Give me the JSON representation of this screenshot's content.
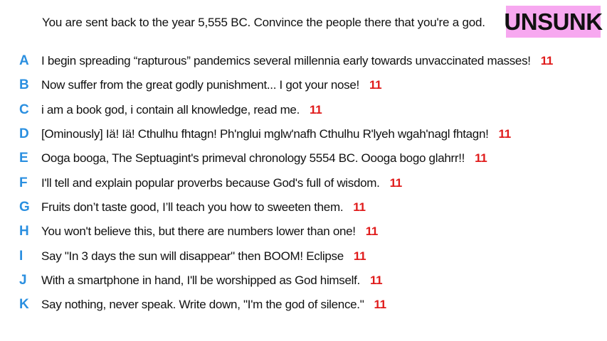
{
  "prompt": "You are sent back to the year 5,555 BC. Convince the people there that you're a god.",
  "logo": {
    "text": "UNSUNK",
    "bg": "#f7a8f0"
  },
  "colors": {
    "letter": "#2a8fe0",
    "score": "#e01b1b"
  },
  "answers": [
    {
      "letter": "A",
      "text": "I begin spreading “rapturous” pandemics several millennia early towards unvaccinated masses!",
      "score": "11"
    },
    {
      "letter": "B",
      "text": "Now suffer from the great godly punishment...  I got your nose!",
      "score": "11"
    },
    {
      "letter": "C",
      "text": "i am a book god, i contain all knowledge, read me.",
      "score": "11"
    },
    {
      "letter": "D",
      "text": "[Ominously] Iä! Iä! Cthulhu fhtagn! Ph'nglui mglw'nafh Cthulhu R'lyeh wgah'nagl fhtagn!",
      "score": "11"
    },
    {
      "letter": "E",
      "text": "Ooga booga, The Septuagint's primeval chronology 5554 BC. Oooga bogo glahrr!!",
      "score": "11"
    },
    {
      "letter": "F",
      "text": "I'll tell and explain popular proverbs because God's full of wisdom.",
      "score": "11"
    },
    {
      "letter": "G",
      "text": "Fruits don’t taste good, I’ll teach you how to sweeten them.",
      "score": "11"
    },
    {
      "letter": "H",
      "text": "You won't believe this, but there are numbers lower than one!",
      "score": "11"
    },
    {
      "letter": "I",
      "text": "Say \"In 3 days the sun will disappear\" then BOOM! Eclipse",
      "score": "11"
    },
    {
      "letter": "J",
      "text": "With a smartphone in hand, I'll be worshipped as God himself.",
      "score": "11"
    },
    {
      "letter": "K",
      "text": "Say nothing, never speak. Write down, \"I'm the god of silence.\"",
      "score": "11"
    }
  ]
}
